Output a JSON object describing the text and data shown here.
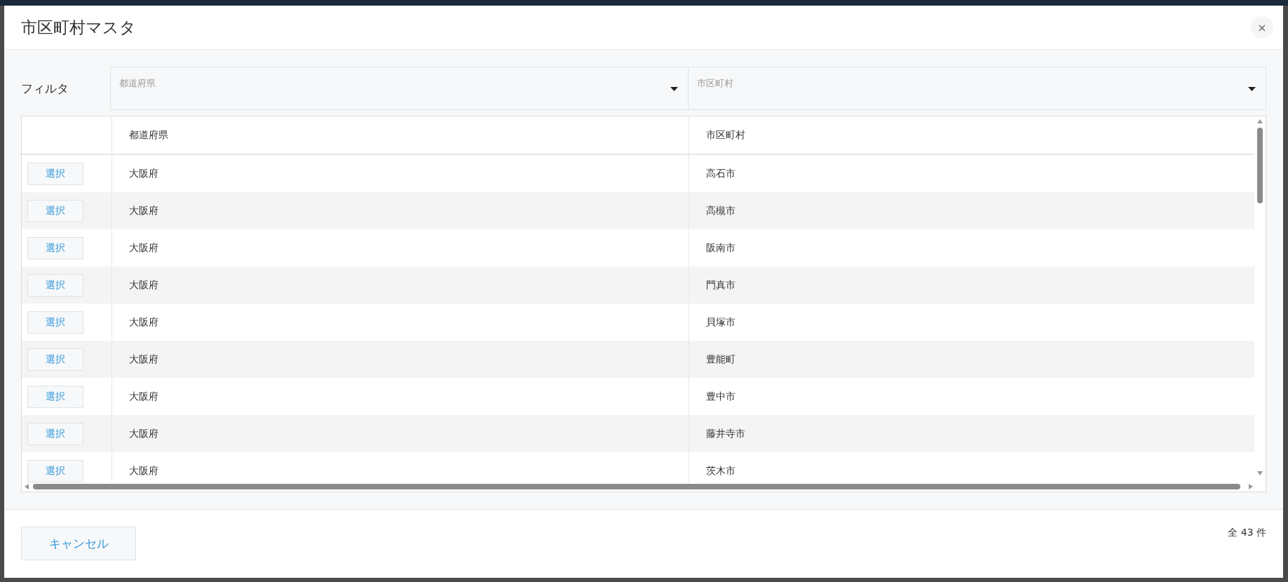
{
  "dialog": {
    "title": "市区町村マスタ",
    "close_icon": "×"
  },
  "filter": {
    "label": "フィルタ",
    "fields": [
      {
        "placeholder": "都道府県"
      },
      {
        "placeholder": "市区町村"
      }
    ]
  },
  "table": {
    "columns": [
      "都道府県",
      "市区町村"
    ],
    "rows": [
      {
        "button": "選択",
        "prefecture": "大阪府",
        "city": "高石市"
      },
      {
        "button": "選択",
        "prefecture": "大阪府",
        "city": "高槻市"
      },
      {
        "button": "選択",
        "prefecture": "大阪府",
        "city": "阪南市"
      },
      {
        "button": "選択",
        "prefecture": "大阪府",
        "city": "門真市"
      },
      {
        "button": "選択",
        "prefecture": "大阪府",
        "city": "貝塚市"
      },
      {
        "button": "選択",
        "prefecture": "大阪府",
        "city": "豊能町"
      },
      {
        "button": "選択",
        "prefecture": "大阪府",
        "city": "豊中市"
      },
      {
        "button": "選択",
        "prefecture": "大阪府",
        "city": "藤井寺市"
      },
      {
        "button": "選択",
        "prefecture": "大阪府",
        "city": "茨木市"
      }
    ]
  },
  "footer": {
    "cancel": "キャンセル",
    "count": "全 43 件"
  }
}
